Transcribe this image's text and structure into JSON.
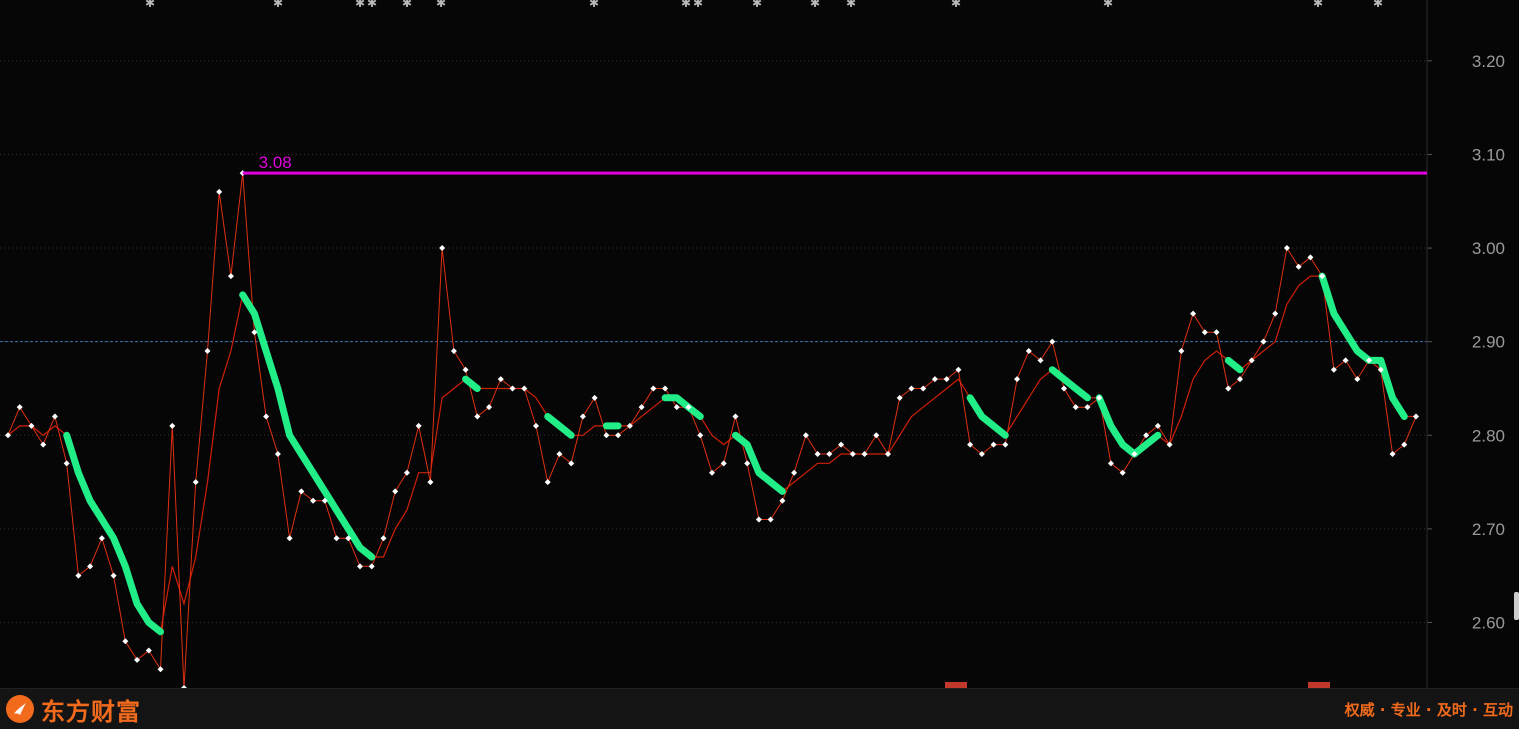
{
  "chart_data": {
    "type": "line",
    "ylim": [
      2.53,
      3.265
    ],
    "y_ticks": [
      "3.20",
      "3.10",
      "3.00",
      "2.90",
      "2.80",
      "2.70",
      "2.60"
    ],
    "grid": true,
    "highlight_line": {
      "value": 3.08,
      "label": "3.08",
      "color": "#e000e0"
    },
    "reference_line": {
      "value": 2.9,
      "color": "#3f6fb0"
    },
    "series": [
      {
        "style": "thin-red-with-white-points",
        "color": "#e03010",
        "values": [
          2.8,
          2.83,
          2.81,
          2.79,
          2.82,
          2.77,
          2.65,
          2.66,
          2.69,
          2.65,
          2.58,
          2.56,
          2.57,
          2.55,
          2.81,
          2.53,
          2.75,
          2.89,
          3.06,
          2.97,
          3.08,
          2.91,
          2.82,
          2.78,
          2.69,
          2.74,
          2.73,
          2.73,
          2.69,
          2.69,
          2.66,
          2.66,
          2.69,
          2.74,
          2.76,
          2.81,
          2.75,
          3.0,
          2.89,
          2.87,
          2.82,
          2.83,
          2.86,
          2.85,
          2.85,
          2.81,
          2.75,
          2.78,
          2.77,
          2.82,
          2.84,
          2.8,
          2.8,
          2.81,
          2.83,
          2.85,
          2.85,
          2.83,
          2.83,
          2.8,
          2.76,
          2.77,
          2.82,
          2.77,
          2.71,
          2.71,
          2.73,
          2.76,
          2.8,
          2.78,
          2.78,
          2.79,
          2.78,
          2.78,
          2.8,
          2.78,
          2.84,
          2.85,
          2.85,
          2.86,
          2.86,
          2.87,
          2.79,
          2.78,
          2.79,
          2.79,
          2.86,
          2.89,
          2.88,
          2.9,
          2.85,
          2.83,
          2.83,
          2.84,
          2.77,
          2.76,
          2.78,
          2.8,
          2.81,
          2.79,
          2.89,
          2.93,
          2.91,
          2.91,
          2.85,
          2.86,
          2.88,
          2.9,
          2.93,
          3.0,
          2.98,
          2.99,
          2.97,
          2.87,
          2.88,
          2.86,
          2.88,
          2.87,
          2.78,
          2.79,
          2.82
        ]
      },
      {
        "style": "moving-average",
        "color": "#d02008",
        "values": [
          2.8,
          2.81,
          2.81,
          2.8,
          2.81,
          2.8,
          2.76,
          2.73,
          2.71,
          2.69,
          2.66,
          2.62,
          2.6,
          2.59,
          2.66,
          2.62,
          2.67,
          2.75,
          2.85,
          2.89,
          2.95,
          2.93,
          2.89,
          2.85,
          2.8,
          2.78,
          2.76,
          2.74,
          2.72,
          2.7,
          2.68,
          2.67,
          2.67,
          2.7,
          2.72,
          2.76,
          2.76,
          2.84,
          2.85,
          2.86,
          2.85,
          2.85,
          2.85,
          2.85,
          2.85,
          2.84,
          2.82,
          2.81,
          2.8,
          2.8,
          2.81,
          2.81,
          2.81,
          2.81,
          2.82,
          2.83,
          2.84,
          2.84,
          2.83,
          2.82,
          2.8,
          2.79,
          2.8,
          2.79,
          2.76,
          2.75,
          2.74,
          2.75,
          2.76,
          2.77,
          2.77,
          2.78,
          2.78,
          2.78,
          2.78,
          2.78,
          2.8,
          2.82,
          2.83,
          2.84,
          2.85,
          2.86,
          2.84,
          2.82,
          2.81,
          2.8,
          2.82,
          2.84,
          2.86,
          2.87,
          2.86,
          2.85,
          2.84,
          2.84,
          2.81,
          2.79,
          2.78,
          2.79,
          2.8,
          2.79,
          2.82,
          2.86,
          2.88,
          2.89,
          2.88,
          2.87,
          2.88,
          2.89,
          2.9,
          2.94,
          2.96,
          2.97,
          2.97,
          2.93,
          2.91,
          2.89,
          2.88,
          2.88,
          2.84,
          2.82,
          2.82
        ]
      }
    ],
    "down_trend_segments": {
      "color": "#22ee88",
      "segments": [
        [
          5,
          13
        ],
        [
          20,
          31
        ],
        [
          39,
          40
        ],
        [
          46,
          48
        ],
        [
          51,
          52
        ],
        [
          56,
          59
        ],
        [
          62,
          66
        ],
        [
          82,
          85
        ],
        [
          89,
          92
        ],
        [
          93,
          98
        ],
        [
          104,
          105
        ],
        [
          112,
          119
        ]
      ]
    },
    "top_markers_color": "#b8b8b8"
  },
  "footer": {
    "brand": "东方财富",
    "slogan": "权威 · 专业 · 及时 · 互动",
    "brand_color": "#f26b1d"
  }
}
